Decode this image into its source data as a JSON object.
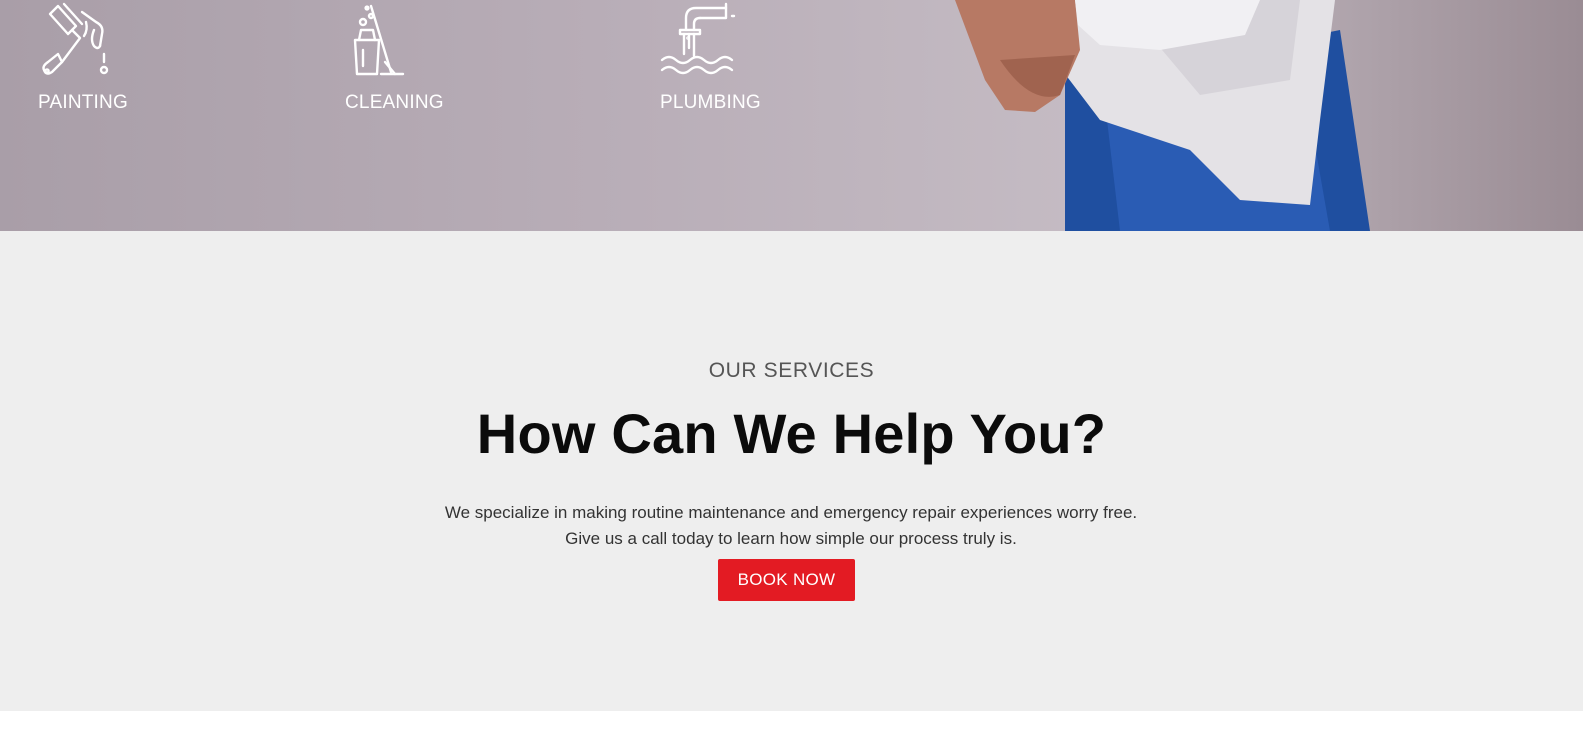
{
  "hero": {
    "services": [
      {
        "label": "PAINTING",
        "icon": "paint-roller-icon"
      },
      {
        "label": "CLEANING",
        "icon": "mop-bucket-icon"
      },
      {
        "label": "PLUMBING",
        "icon": "faucet-water-icon"
      }
    ]
  },
  "services_section": {
    "eyebrow": "OUR SERVICES",
    "headline": "How Can We Help You?",
    "description": "We specialize in making routine maintenance and emergency repair experiences worry free. Give us a call today to learn how simple our process truly is.",
    "cta_label": "BOOK NOW"
  },
  "colors": {
    "cta": "#e31b23",
    "section_background": "#eeeeee",
    "hero_tint": "#b9aeb8",
    "worker_overall": "#1f4fa0"
  }
}
